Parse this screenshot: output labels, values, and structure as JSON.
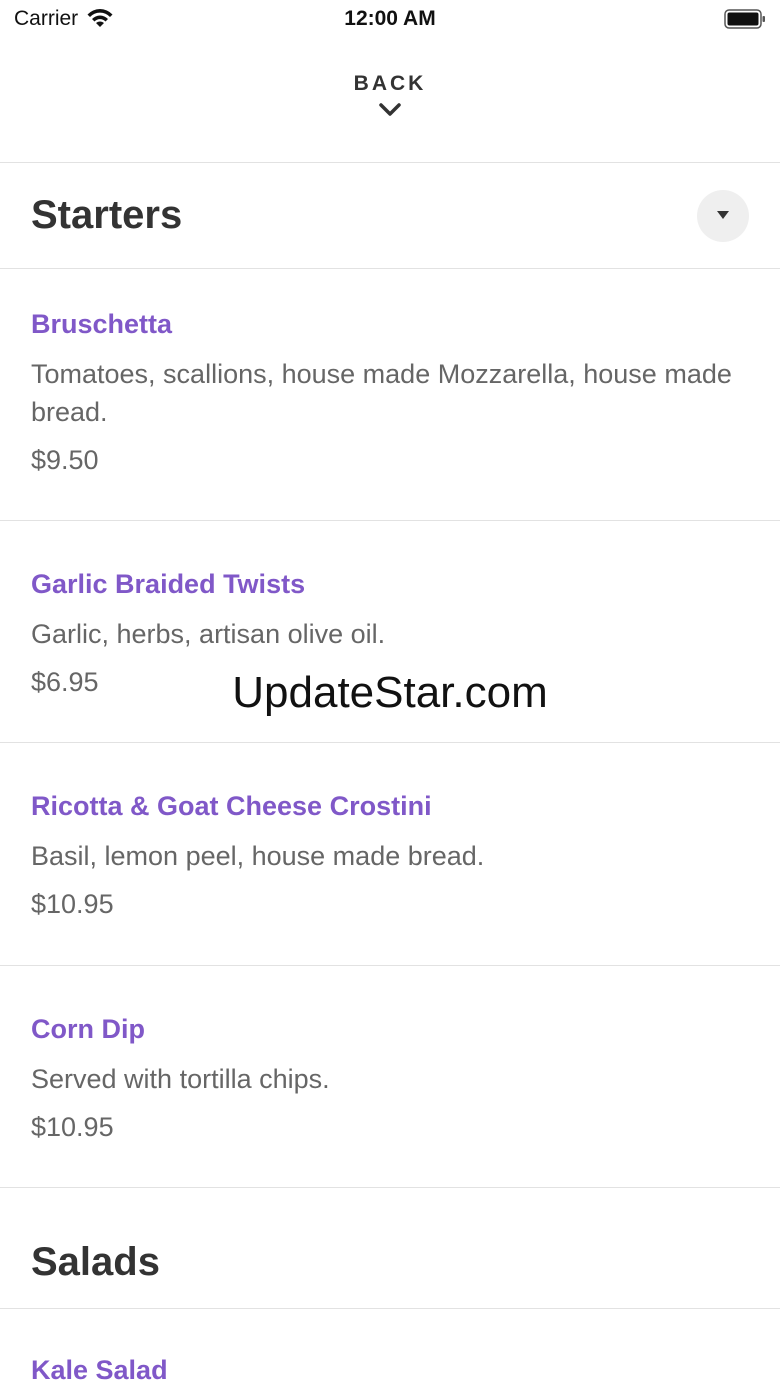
{
  "status_bar": {
    "carrier": "Carrier",
    "time": "12:00 AM"
  },
  "header": {
    "back_label": "BACK"
  },
  "sections": [
    {
      "title": "Starters",
      "items": [
        {
          "name": "Bruschetta",
          "description": "Tomatoes, scallions, house made Mozzarella, house made bread.",
          "price": "$9.50"
        },
        {
          "name": "Garlic Braided Twists",
          "description": "Garlic, herbs, artisan olive oil.",
          "price": "$6.95"
        },
        {
          "name": "Ricotta & Goat Cheese Crostini",
          "description": "Basil, lemon peel, house made bread.",
          "price": "$10.95"
        },
        {
          "name": "Corn Dip",
          "description": "Served with tortilla chips.",
          "price": "$10.95"
        }
      ]
    },
    {
      "title": "Salads",
      "items": [
        {
          "name": "Kale Salad"
        }
      ]
    }
  ],
  "watermark": "UpdateStar.com",
  "colors": {
    "accent": "#8058c8",
    "text": "#333333",
    "muted": "#666666",
    "divider": "#e2e2e2"
  },
  "icons": [
    "wifi-icon",
    "battery-icon",
    "chevron-down-icon",
    "caret-down-icon"
  ]
}
